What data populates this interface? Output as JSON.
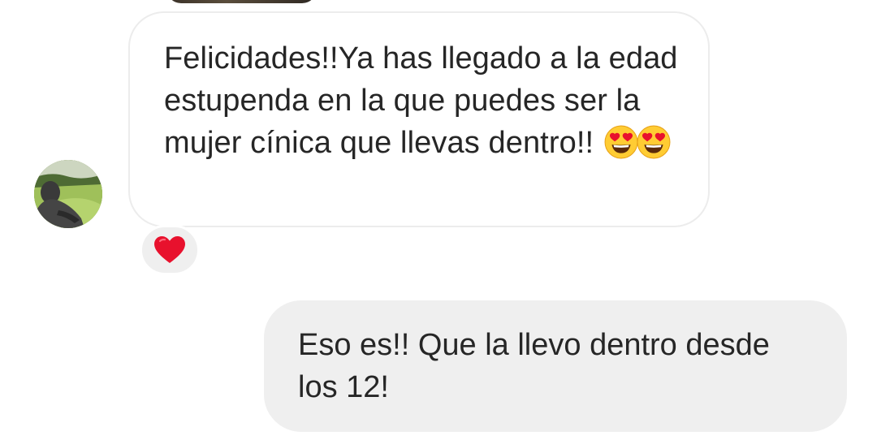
{
  "conversation": {
    "incoming_message": {
      "text": "Felicidades!!Ya has llegado a la edad estupenda en la que puedes ser la mujer cínica que llevas dentro!!",
      "emojis": [
        "smiling-face-with-heart-eyes",
        "smiling-face-with-heart-eyes"
      ],
      "reaction": "red-heart"
    },
    "outgoing_message": {
      "text": "Eso es!! Que la llevo dentro desde los 12!"
    }
  },
  "colors": {
    "incoming_bubble_border": "#ececec",
    "outgoing_bubble_bg": "#efefef",
    "text": "#262626",
    "heart": "#e8112d"
  }
}
